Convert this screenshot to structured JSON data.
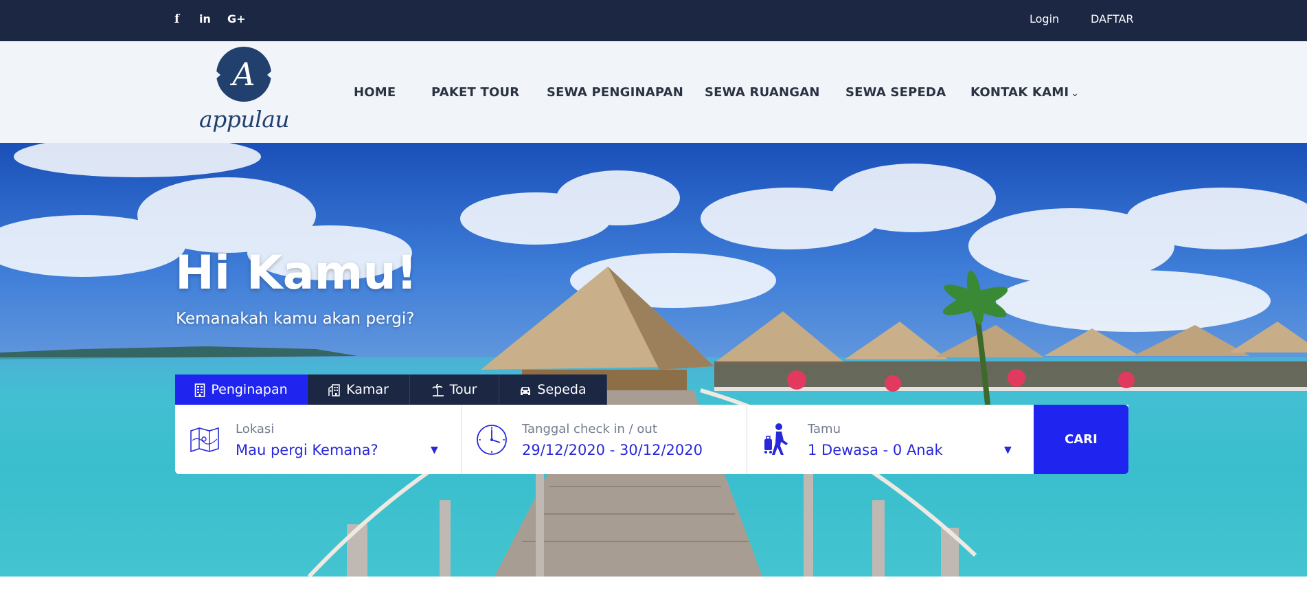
{
  "topbar": {
    "social": [
      {
        "icon": "facebook-icon",
        "glyph": "f"
      },
      {
        "icon": "linkedin-icon",
        "glyph": "in"
      },
      {
        "icon": "google-plus-icon",
        "glyph": "G+"
      }
    ],
    "login_label": "Login",
    "register_label": "DAFTAR"
  },
  "header": {
    "logo_letter": "A",
    "logo_text": "appulau",
    "nav": [
      {
        "label": "HOME"
      },
      {
        "label": "PAKET TOUR"
      },
      {
        "label": "SEWA PENGINAPAN"
      },
      {
        "label": "SEWA RUANGAN"
      },
      {
        "label": "SEWA SEPEDA"
      },
      {
        "label": "KONTAK KAMI",
        "dropdown": true
      }
    ]
  },
  "hero": {
    "title": "Hi Kamu!",
    "subtitle": "Kemanakah kamu akan pergi?"
  },
  "search": {
    "tabs": [
      {
        "label": "Penginapan",
        "icon": "building-icon",
        "active": true
      },
      {
        "label": "Kamar",
        "icon": "hotel-icon",
        "active": false
      },
      {
        "label": "Tour",
        "icon": "island-icon",
        "active": false
      },
      {
        "label": "Sepeda",
        "icon": "car-icon",
        "active": false
      }
    ],
    "location": {
      "label": "Lokasi",
      "value": "Mau pergi Kemana?",
      "icon": "map-icon"
    },
    "dates": {
      "label": "Tanggal check in / out",
      "value": "29/12/2020 - 30/12/2020",
      "icon": "clock-icon"
    },
    "guests": {
      "label": "Tamu",
      "value": "1 Dewasa - 0 Anak",
      "icon": "traveler-icon"
    },
    "submit_label": "CARI"
  },
  "colors": {
    "topbar": "#1c2744",
    "header_bg": "#f1f4f8",
    "accent": "#1f25ee",
    "value_text": "#2828d8",
    "logo": "#21406e"
  }
}
